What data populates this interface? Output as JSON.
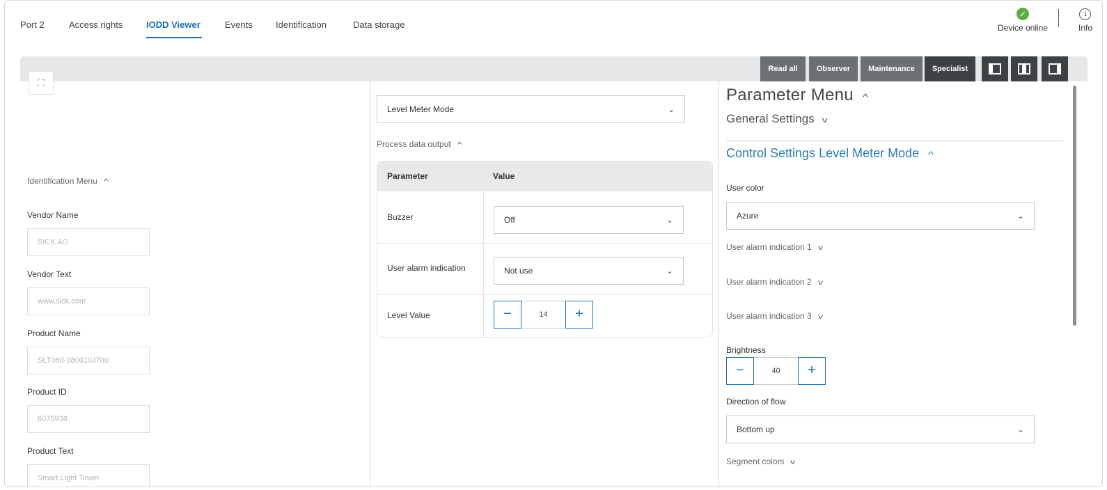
{
  "tabs": [
    {
      "label": "Port 2"
    },
    {
      "label": "Access rights"
    },
    {
      "label": "IODD Viewer"
    },
    {
      "label": "Events"
    },
    {
      "label": "Identification"
    },
    {
      "label": "Data storage"
    }
  ],
  "active_tab": "IODD Viewer",
  "status": {
    "label": "Device online",
    "icon": "check-circle-icon",
    "color": "#5cae43"
  },
  "info": {
    "label": "Info",
    "icon": "info-icon"
  },
  "toolbar": {
    "read_all": "Read all",
    "observer": "Observer",
    "maintenance": "Maintenance",
    "specialist": "Specialist",
    "layout_icons": [
      "layout-left-icon",
      "layout-center-icon",
      "layout-right-icon"
    ]
  },
  "left_panel": {
    "section_title": "Identification Menu",
    "fields": [
      {
        "label": "Vendor Name",
        "value": "SICK AG"
      },
      {
        "label": "Vendor Text",
        "value": "www.sick.com"
      },
      {
        "label": "Product Name",
        "value": "SLT060-080010J700"
      },
      {
        "label": "Product ID",
        "value": "6075938"
      },
      {
        "label": "Product Text",
        "value": "Smart Light Tower"
      }
    ]
  },
  "middle_panel": {
    "mode_select": "Level Meter Mode",
    "section_title": "Process data output",
    "table": {
      "headers": [
        "Parameter",
        "Value"
      ],
      "rows": [
        {
          "param": "Buzzer",
          "value": "Off"
        },
        {
          "param": "User alarm indication",
          "value": "Not use"
        },
        {
          "param": "Level Value",
          "value": "14"
        }
      ]
    }
  },
  "right_panel": {
    "title": "Parameter Menu",
    "general": "General Settings",
    "control": "Control Settings Level Meter Mode",
    "user_color_label": "User color",
    "user_color_value": "Azure",
    "alarm1": "User alarm indication 1",
    "alarm2": "User alarm indication 2",
    "alarm3": "User alarm indication 3",
    "brightness_label": "Brightness",
    "brightness_value": "40",
    "flow_label": "Direction of flow",
    "flow_value": "Bottom up",
    "segment_colors": "Segment colors"
  },
  "colors": {
    "accent": "#1b6fb5",
    "link": "#2a7bbd",
    "toolbar_dark": "#3d4143",
    "toolbar_gray": "#6c7072"
  }
}
